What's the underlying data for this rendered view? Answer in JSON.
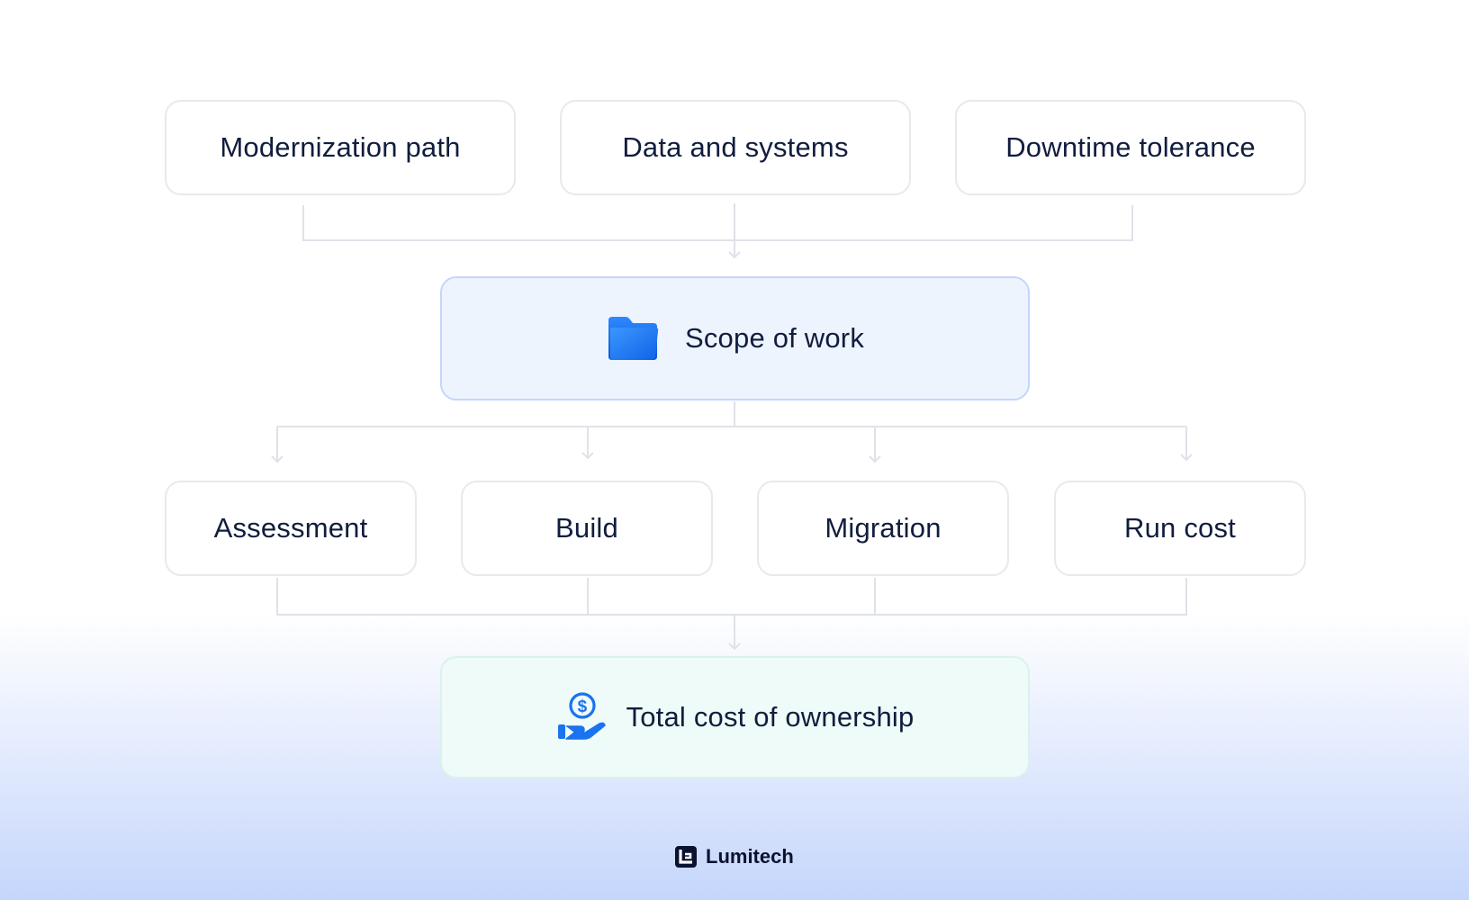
{
  "inputs": [
    {
      "label": "Modernization path"
    },
    {
      "label": "Data and systems"
    },
    {
      "label": "Downtime tolerance"
    }
  ],
  "scope": {
    "label": "Scope of work",
    "icon": "folder-icon",
    "icon_color": "#1a6ef0"
  },
  "components": [
    {
      "label": "Assessment"
    },
    {
      "label": "Build"
    },
    {
      "label": "Migration"
    },
    {
      "label": "Run cost"
    }
  ],
  "result": {
    "label": "Total cost of ownership",
    "icon": "hand-dollar-icon",
    "icon_color": "#1a73f0"
  },
  "brand": {
    "name": "Lumitech",
    "icon": "lumitech-logo-icon"
  },
  "colors": {
    "connector": "#dfe2e8",
    "scope_bg": "#eef4fe",
    "result_bg": "#effbf8",
    "text": "#111d3e"
  }
}
